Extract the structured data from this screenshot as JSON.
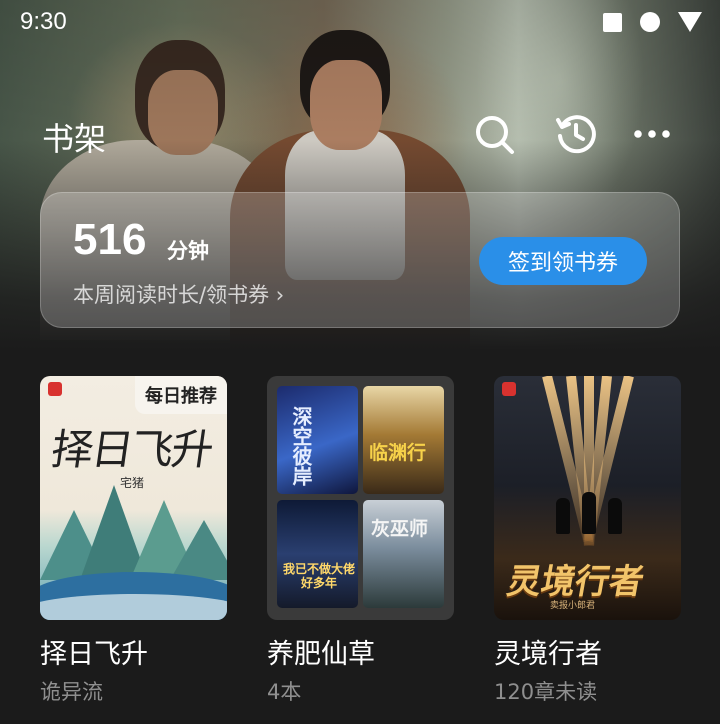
{
  "status_bar": {
    "time": "9:30"
  },
  "header": {
    "title": "书架",
    "search_icon": "search-icon",
    "history_icon": "history-icon",
    "more_icon": "more-icon"
  },
  "reading_card": {
    "minutes": "516",
    "minutes_unit": "分钟",
    "week_link": "本周阅读时长/领书券 ›",
    "checkin_label": "签到领书券"
  },
  "books": [
    {
      "title": "择日飞升",
      "subtitle": "诡异流",
      "badge": "每日推荐",
      "cover_title": "择日飞升",
      "cover_author": "宅猪"
    },
    {
      "title": "养肥仙草",
      "subtitle": "4本",
      "mini_covers": [
        "深空彼岸",
        "临渊行",
        "我已不做大佬好多年",
        "灰巫师"
      ]
    },
    {
      "title": "灵境行者",
      "subtitle": "120章未读",
      "cover_title": "灵境行者",
      "cover_author": "卖报小郎君"
    }
  ],
  "colors": {
    "accent": "#2a8fe8",
    "background": "#1b1b1b",
    "muted_text": "#8f8f8f"
  }
}
